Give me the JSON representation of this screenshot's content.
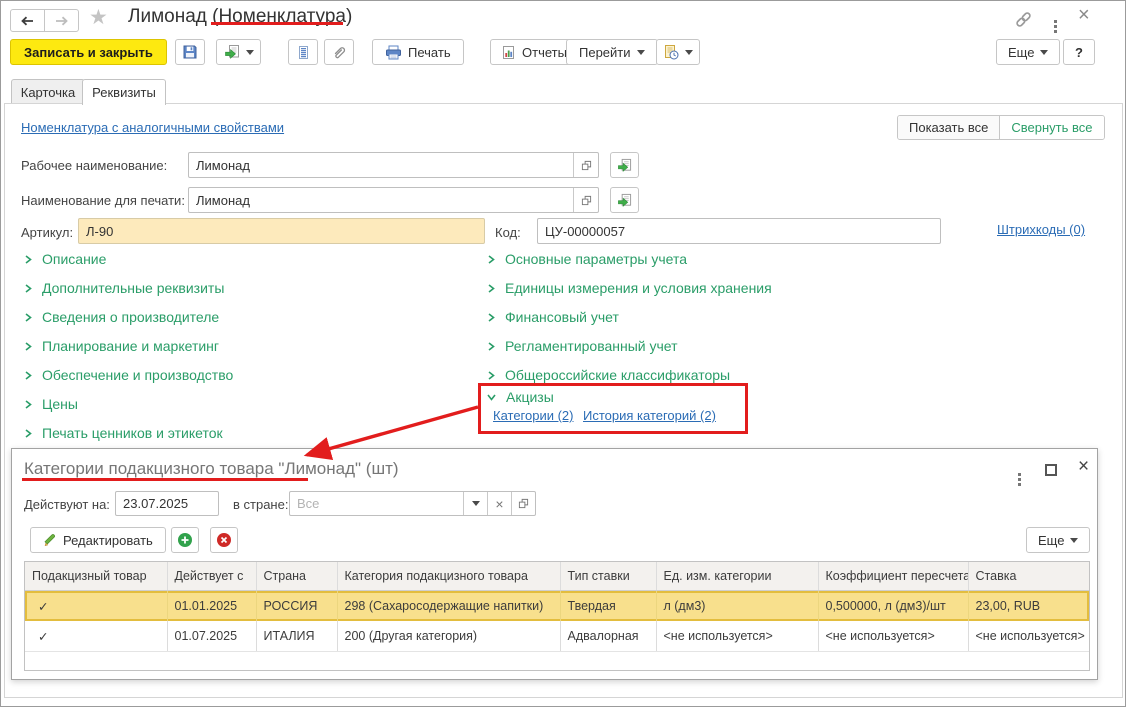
{
  "window": {
    "title": "Лимонад (Номенклатура)",
    "help": "?"
  },
  "toolbar": {
    "save_close": "Записать и закрыть",
    "print": "Печать",
    "reports": "Отчеты",
    "goto": "Перейти",
    "more": "Еще"
  },
  "tabs": {
    "card": "Карточка",
    "details": "Реквизиты"
  },
  "form": {
    "similar_link": "Номенклатура с аналогичными свойствами",
    "show_all": "Показать все",
    "collapse_all": "Свернуть все",
    "working_name_label": "Рабочее наименование:",
    "working_name_value": "Лимонад",
    "print_name_label": "Наименование для печати:",
    "print_name_value": "Лимонад",
    "article_label": "Артикул:",
    "article_value": "Л-90",
    "code_label": "Код:",
    "code_value": "ЦУ-00000057",
    "barcodes_link": "Штрихкоды (0)",
    "sections_left": [
      "Описание",
      "Дополнительные реквизиты",
      "Сведения о производителе",
      "Планирование и маркетинг",
      "Обеспечение и производство",
      "Цены",
      "Печать ценников и этикеток"
    ],
    "sections_right": [
      "Основные параметры учета",
      "Единицы измерения и условия хранения",
      "Финансовый учет",
      "Регламентированный учет",
      "Общероссийские классификаторы"
    ],
    "excise_label": "Акцизы",
    "excise_links": [
      "Категории (2)",
      "История категорий (2)"
    ]
  },
  "dialog": {
    "title": "Категории подакцизного товара \"Лимонад\" (шт)",
    "date_label": "Действуют на:",
    "date_value": "23.07.2025",
    "country_label": "в стране:",
    "country_placeholder": "Все",
    "edit": "Редактировать",
    "more": "Еще",
    "table": {
      "headers": [
        "Подакцизный товар",
        "Действует с",
        "Страна",
        "Категория подакцизного товара",
        "Тип ставки",
        "Ед. изм. категории",
        "Коэффициент пересчета",
        "Ставка"
      ],
      "rows": [
        {
          "check": "✓",
          "date": "01.01.2025",
          "country": "РОССИЯ",
          "category": "298 (Сахаросодержащие напитки)",
          "rate_type": "Твердая",
          "unit": "л (дм3)",
          "coeff": "0,500000, л (дм3)/шт",
          "rate": "23,00, RUB"
        },
        {
          "check": "✓",
          "date": "01.07.2025",
          "country": "ИТАЛИЯ",
          "category": "200 (Другая категория)",
          "rate_type": "Адвалорная",
          "unit": "<не используется>",
          "coeff": "<не используется>",
          "rate": "<не используется>"
        }
      ]
    }
  },
  "colors": {
    "accent_yellow": "#fde910",
    "article_bg": "#fdeabc",
    "selected_row": "#f8e08d",
    "selected_row_border": "#e3bd3e",
    "section_green": "#2a9d68",
    "link_blue": "#2b6cb5",
    "annotation_red": "#e21d1d"
  }
}
